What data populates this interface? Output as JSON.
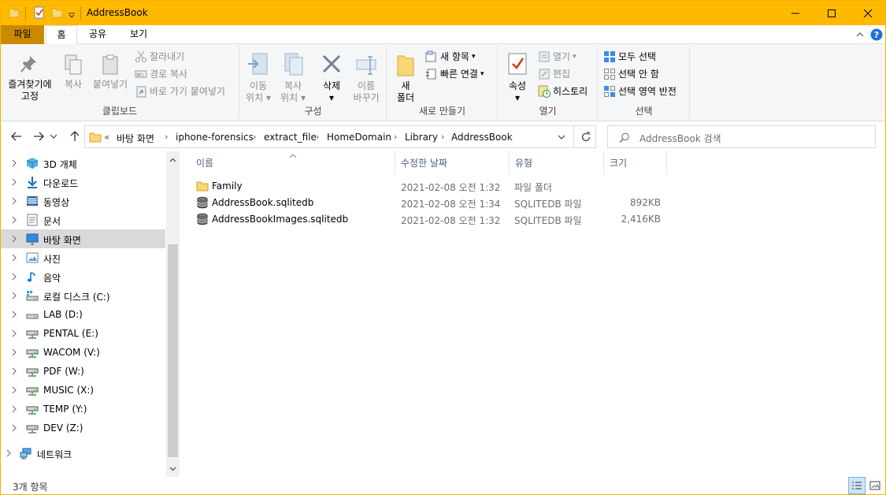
{
  "window": {
    "title": "AddressBook"
  },
  "accent": "#ffb900",
  "ribbon_tabs": {
    "file": "파일",
    "home": "홈",
    "share": "공유",
    "view": "보기"
  },
  "ribbon": {
    "clipboard": {
      "label": "클립보드",
      "pin_line1": "즐겨찾기에",
      "pin_line2": "고정",
      "copy": "복사",
      "paste": "붙여넣기",
      "cut": "잘라내기",
      "copy_path": "경로 복사",
      "paste_shortcut": "바로 가기 붙여넣기"
    },
    "organize": {
      "label": "구성",
      "move_line1": "이동",
      "move_line2": "위치",
      "copyto_line1": "복사",
      "copyto_line2": "위치",
      "delete": "삭제",
      "rename_line1": "이름",
      "rename_line2": "바꾸기"
    },
    "new": {
      "label": "새로 만들기",
      "folder_line1": "새",
      "folder_line2": "폴더",
      "new_item": "새 항목",
      "easy_access": "빠른 연결"
    },
    "open": {
      "label": "열기",
      "properties": "속성",
      "open": "열기",
      "edit": "편집",
      "history": "히스토리"
    },
    "select": {
      "label": "선택",
      "select_all": "모두 선택",
      "select_none": "선택 안 함",
      "invert": "선택 영역 반전"
    }
  },
  "address": {
    "overflow": "«",
    "crumbs": [
      "바탕 화면",
      "iphone-forensics",
      "extract_file",
      "HomeDomain",
      "Library",
      "AddressBook"
    ],
    "search_placeholder": "AddressBook 검색"
  },
  "nav": [
    {
      "label": "3D 개체",
      "icon": "3d-objects-icon"
    },
    {
      "label": "다운로드",
      "icon": "downloads-icon"
    },
    {
      "label": "동영상",
      "icon": "videos-icon"
    },
    {
      "label": "문서",
      "icon": "documents-icon"
    },
    {
      "label": "바탕 화면",
      "icon": "desktop-icon",
      "selected": true
    },
    {
      "label": "사진",
      "icon": "pictures-icon"
    },
    {
      "label": "음악",
      "icon": "music-icon"
    },
    {
      "label": "로컬 디스크 (C:)",
      "icon": "system-drive-icon"
    },
    {
      "label": "LAB (D:)",
      "icon": "drive-icon"
    },
    {
      "label": "PENTAL (E:)",
      "icon": "network-drive-icon"
    },
    {
      "label": "WACOM (V:)",
      "icon": "network-drive-icon"
    },
    {
      "label": "PDF (W:)",
      "icon": "network-drive-icon"
    },
    {
      "label": "MUSIC (X:)",
      "icon": "network-drive-icon"
    },
    {
      "label": "TEMP (Y:)",
      "icon": "network-drive-icon"
    },
    {
      "label": "DEV (Z:)",
      "icon": "network-drive-icon"
    },
    {
      "label": "네트워크",
      "icon": "network-icon"
    }
  ],
  "columns": {
    "name": "이름",
    "modified": "수정한 날짜",
    "type": "유형",
    "size": "크기"
  },
  "files": [
    {
      "name": "Family",
      "modified": "2021-02-08 오전 1:32",
      "type": "파일 폴더",
      "size": "",
      "icon": "folder-icon"
    },
    {
      "name": "AddressBook.sqlitedb",
      "modified": "2021-02-08 오전 1:34",
      "type": "SQLITEDB 파일",
      "size": "892KB",
      "icon": "database-file-icon"
    },
    {
      "name": "AddressBookImages.sqlitedb",
      "modified": "2021-02-08 오전 1:32",
      "type": "SQLITEDB 파일",
      "size": "2,416KB",
      "icon": "database-file-icon"
    }
  ],
  "status": {
    "count": "3개 항목"
  }
}
